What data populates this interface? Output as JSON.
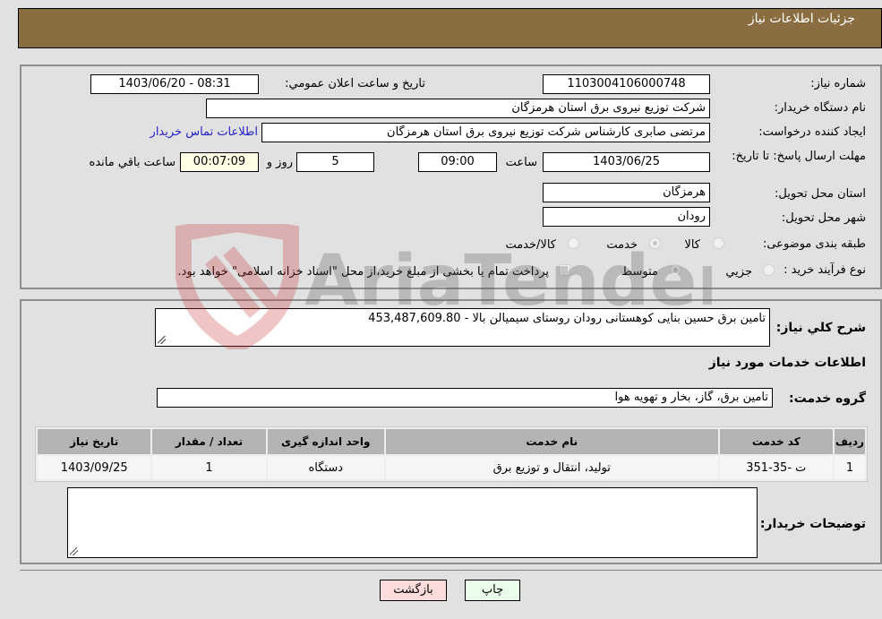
{
  "header": {
    "title": "جزئیات اطلاعات نیاز"
  },
  "fields": {
    "need_number_label": "شماره نیاز:",
    "need_number": "1103004106000748",
    "announce_label": "تاريخ و ساعت اعلان عمومي:",
    "announce_value": "1403/06/20 - 08:31",
    "buyer_org_label": "نام دستگاه خريدار:",
    "buyer_org": "شرکت توزیع نیروی برق استان هرمزگان",
    "creator_label": "ايجاد کننده درخواست:",
    "creator": "مرتضی صابری کارشناس شرکت توزیع نیروی برق استان هرمزگان",
    "contact_link": "اطلاعات تماس خريدار",
    "deadline_label": "مهلت ارسال پاسخ: تا تاريخ:",
    "deadline_date": "1403/06/25",
    "time_label": "ساعت",
    "deadline_time": "09:00",
    "days_value": "5",
    "days_label": "روز و",
    "remaining_time": "00:07:09",
    "remaining_label": "ساعت باقي مانده",
    "province_label": "استان محل تحويل:",
    "province": "هرمزگان",
    "city_label": "شهر محل تحويل:",
    "city": "رودان",
    "category_label": "طبقه بندی موضوعی:",
    "category_options": [
      "کالا",
      "خدمت",
      "کالا/خدمت"
    ],
    "category_selected": "خدمت",
    "process_label": "نوع فرآيند خريد :",
    "process_options": [
      "جزيي",
      "متوسط"
    ],
    "process_selected": "متوسط",
    "treasury_note": "پرداخت تمام يا بخشی از مبلغ خريد،از محل \"اسناد خزانه اسلامی\" خواهد بود."
  },
  "details": {
    "description_label": "شرح کلي نياز:",
    "description": "تامین برق حسین بنایی کوهستانی رودان روستای سیمیالن بالا - 453,487,609.80",
    "services_heading": "اطلاعات خدمات مورد نياز",
    "service_group_label": "گروه خدمت:",
    "service_group": "تامین برق، گاز، بخار و تهویه هوا",
    "table": {
      "headers": [
        "رديف",
        "کد خدمت",
        "نام خدمت",
        "واحد اندازه گيری",
        "تعداد / مقدار",
        "تاريخ نياز"
      ],
      "rows": [
        [
          "1",
          "ت -35-351",
          "تولید، انتقال و توزیع برق",
          "دستگاه",
          "1",
          "1403/09/25"
        ]
      ]
    },
    "buyer_notes_label": "توضيحات خريدار:",
    "buyer_notes": ""
  },
  "buttons": {
    "print": "چاپ",
    "back": "بازگشت"
  },
  "watermark": {
    "text": "AriaTender.neT"
  }
}
